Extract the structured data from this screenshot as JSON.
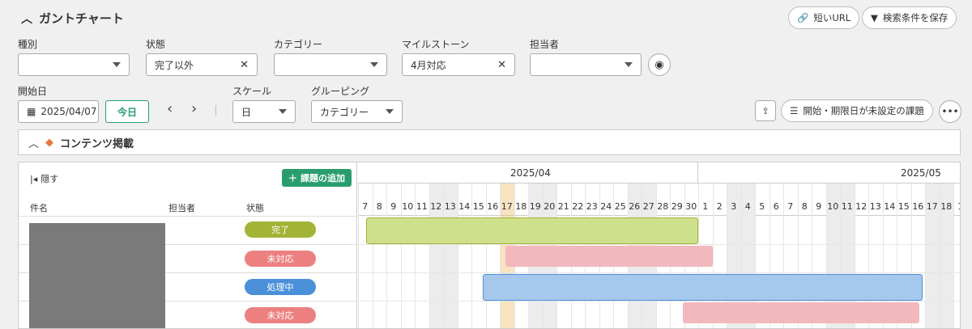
{
  "header": {
    "title": "ガントチャート",
    "short_url": "短いURL",
    "save_search": "検索条件を保存"
  },
  "filters": {
    "kind_label": "種別",
    "kind_value": "",
    "status_label": "状態",
    "status_value": "完了以外",
    "category_label": "カテゴリー",
    "category_value": "",
    "milestone_label": "マイルストーン",
    "milestone_value": "4月対応",
    "assignee_label": "担当者",
    "assignee_value": "",
    "start_label": "開始日",
    "start_value": "2025/04/07",
    "today_label": "今日",
    "scale_label": "スケール",
    "scale_value": "日",
    "grouping_label": "グルーピング",
    "grouping_value": "カテゴリー",
    "unset_label": "開始・期限日が未設定の課題"
  },
  "section": {
    "title": "コンテンツ掲載"
  },
  "table": {
    "hide_label": "隠す",
    "add_label": "課題の追加",
    "col_name": "件名",
    "col_assignee": "担当者",
    "col_status": "状態",
    "rows": [
      {
        "status": "完了",
        "color": "#a3b335"
      },
      {
        "status": "未対応",
        "color": "#ec8080"
      },
      {
        "status": "処理中",
        "color": "#4a90d9"
      },
      {
        "status": "未対応",
        "color": "#ec8080"
      }
    ]
  },
  "gantt": {
    "months": [
      "2025/04",
      "2025/05"
    ],
    "days": [
      "7",
      "8",
      "9",
      "10",
      "11",
      "12",
      "13",
      "14",
      "15",
      "16",
      "17",
      "18",
      "19",
      "20",
      "21",
      "22",
      "23",
      "24",
      "25",
      "26",
      "27",
      "28",
      "29",
      "30",
      "1",
      "2",
      "3",
      "4",
      "5",
      "6",
      "7",
      "8",
      "9",
      "10",
      "11",
      "12",
      "13",
      "14",
      "15",
      "16",
      "17",
      "18",
      "1"
    ],
    "weekend_days": [
      5,
      6,
      12,
      13,
      19,
      20,
      26,
      27,
      33,
      34,
      40,
      41
    ],
    "today_index": 10,
    "bars": [
      {
        "start": 0.55,
        "end": 24.0,
        "color": "#cfe08d",
        "border": "#a3b335",
        "row": 0
      },
      {
        "start": 10.4,
        "end": 25.0,
        "color": "#f2b8be",
        "border": "#f2b8be",
        "row": 1
      },
      {
        "start": 8.8,
        "end": 39.8,
        "color": "#a6c8ec",
        "border": "#4a90d9",
        "row": 2
      },
      {
        "start": 22.9,
        "end": 39.6,
        "color": "#f2b8be",
        "border": "#f2b8be",
        "row": 3
      }
    ]
  }
}
